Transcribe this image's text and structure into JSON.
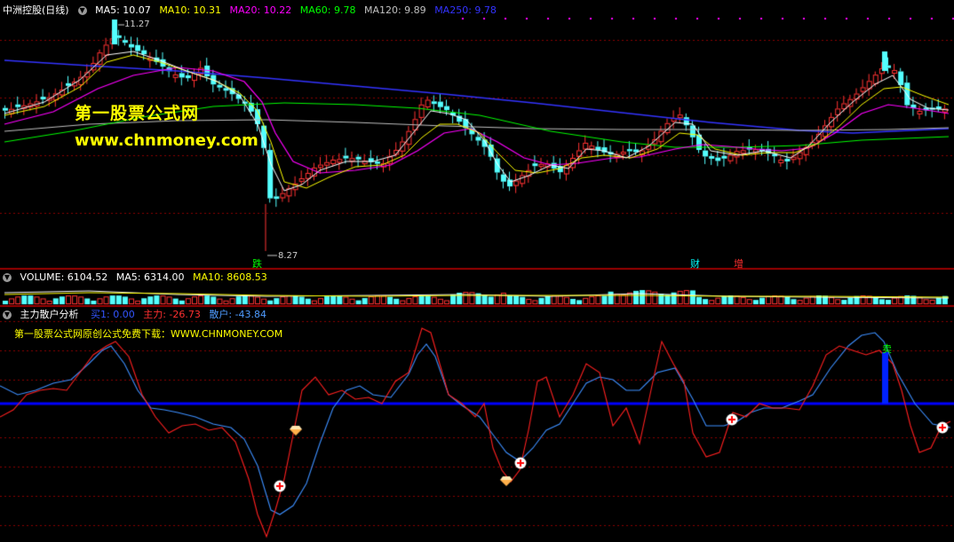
{
  "main": {
    "title": "中洲控股(日线)",
    "ma": [
      {
        "label": "MA5: 10.07",
        "color": "#ffffff"
      },
      {
        "label": "MA10: 10.31",
        "color": "#ffff00"
      },
      {
        "label": "MA20: 10.22",
        "color": "#ff00ff"
      },
      {
        "label": "MA60: 9.78",
        "color": "#00ff00"
      },
      {
        "label": "MA120: 9.89",
        "color": "#c0c0c0"
      },
      {
        "label": "MA250: 9.78",
        "color": "#3333ff"
      }
    ],
    "high_label": "11.27",
    "low_label": "8.27",
    "watermark_cn": "第一股票公式网",
    "watermark_url": "www.chnmoney.com",
    "event_tags": [
      {
        "text": "跌",
        "color": "#00ff00"
      },
      {
        "text": "财",
        "color": "#00ffff"
      },
      {
        "text": "增",
        "color": "#ff3030"
      }
    ]
  },
  "volume": {
    "labels": [
      {
        "label": "VOLUME: 6104.52",
        "color": "#ffffff"
      },
      {
        "label": "MA5: 6314.00",
        "color": "#ffffff"
      },
      {
        "label": "MA10: 8608.53",
        "color": "#ffff00"
      }
    ]
  },
  "indicator": {
    "name": "主力散户分析",
    "values": [
      {
        "label": "买1: 0.00",
        "color": "#3355ff"
      },
      {
        "label": "主力: -26.73",
        "color": "#ff3030"
      },
      {
        "label": "散户: -43.84",
        "color": "#4f9cff"
      }
    ],
    "note": "第一股票公式网原创公式免费下载：WWW.CHNMONEY.COM",
    "sell_label": "卖"
  },
  "colors": {
    "up": "#ff3232",
    "down": "#54ffff",
    "grid": "#8b0000",
    "ma5": "#ffffff",
    "ma10": "#ffff00",
    "ma20": "#ff00ff",
    "ma60": "#00ff00",
    "ma120": "#c0c0c0",
    "ma250": "#3333ff",
    "mainforce": "#ff2020",
    "retail": "#3d8fff",
    "zero": "#0000ff"
  }
}
